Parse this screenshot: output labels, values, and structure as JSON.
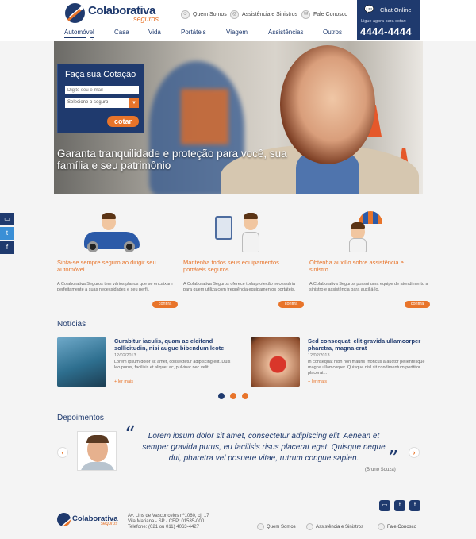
{
  "brand": {
    "name": "Colaborativa",
    "sub": "seguros",
    "navy": "#1f3a6e",
    "orange": "#e8742a"
  },
  "header": {
    "links": [
      {
        "label": "Quem Somos",
        "icon": "people-icon"
      },
      {
        "label": "Assistência e Sinistros",
        "icon": "lifebuoy-icon"
      },
      {
        "label": "Fale Conosco",
        "icon": "mail-icon"
      }
    ],
    "chat": {
      "label": "Chat Online",
      "sub": "Ligue agora para cotar:",
      "phone": "4444-4444"
    }
  },
  "nav": [
    "Automóvel",
    "Casa",
    "Vida",
    "Portáteis",
    "Viagem",
    "Assistências",
    "Outros"
  ],
  "quote_form": {
    "title": "Faça sua Cotação",
    "email_placeholder": "Digite seu e-mail",
    "select_value": "Selecione o seguro",
    "button": "cotar"
  },
  "hero": {
    "headline": "Garanta tranquilidade e proteção para você, sua família e seu patrimônio"
  },
  "features": [
    {
      "title": "Sinta-se sempre seguro ao dirigir seu automóvel.",
      "text": "A Colaborativa Seguros tem vários planos que se encaixam perfeitamente a suas necessidades e seu perfil.",
      "button": "confira"
    },
    {
      "title": "Mantenha todos seus equipamentos portáteis seguros.",
      "text": "A Colaborativa Seguros oferece toda proteção necessária para quem utiliza com frequência equipamentos portáteis.",
      "button": "confira"
    },
    {
      "title": "Obtenha auxílio sobre assistência e sinistro.",
      "text": "A Colaborativa Seguros possui uma equipe de atendimento a sinistro e assistência para auxiliá-lo.",
      "button": "confira"
    }
  ],
  "news": {
    "title": "Notícias",
    "items": [
      {
        "title": "Curabitur iaculis, quam ac eleifend sollicitudin, nisi augue bibendum leote",
        "date": "12/02/2013",
        "text": "Lorem ipsum dolor sit amet, consectetur adipiscing elit. Duis leo purus, facilisis et aliquet ac, pulvinar nec velit.",
        "more": "+ ler mais"
      },
      {
        "title": "Sed consequat, elit gravida ullamcorper pharetra, magna erat",
        "date": "12/02/2013",
        "text": "In consequat nibh non mauris rhoncus a auctor pellentesque magna ullamcorper. Quisque nisl sit condimentum porttitor placerat...",
        "more": "+ ler mais"
      }
    ]
  },
  "testimonials": {
    "title": "Depoimentos",
    "quote": "Lorem ipsum dolor sit amet, consectetur adipiscing elit. Aenean et semper gravida purus, eu facilisis risus placerat eget. Quisque neque dui, pharetra vel posuere vitae, rutrum congue sapien.",
    "author": "(Bruno Souza)"
  },
  "footer": {
    "address": [
      "Av. Lins de Vasconcelos nº1060, cj. 17",
      "Vila Mariana - SP - CEP: 01535-000",
      "Telefone: (021 ou 011) 4063-4427"
    ],
    "links": [
      "Quem Somos",
      "Assistência e Sinistros",
      "Fale Conosco"
    ],
    "social": [
      "chat",
      "t",
      "f"
    ]
  },
  "side_social": [
    "chat",
    "t",
    "f"
  ]
}
